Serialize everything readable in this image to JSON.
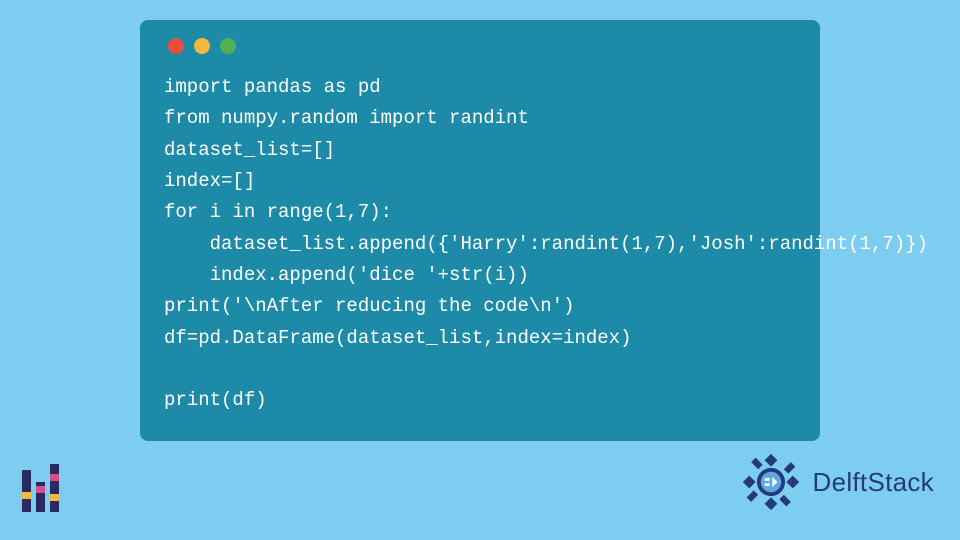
{
  "code": {
    "lines": [
      "import pandas as pd",
      "from numpy.random import randint",
      "dataset_list=[]",
      "index=[]",
      "for i in range(1,7):",
      "    dataset_list.append({'Harry':randint(1,7),'Josh':randint(1,7)})",
      "    index.append('dice '+str(i))",
      "print('\\nAfter reducing the code\\n')",
      "df=pd.DataFrame(dataset_list,index=index)",
      "",
      "print(df)"
    ]
  },
  "brand": {
    "name": "DelftStack"
  },
  "colors": {
    "page_bg": "#7dcdf0",
    "code_bg": "#1d8ba7",
    "code_fg": "#ffffff",
    "dot_red": "#e94f3c",
    "dot_yellow": "#f4b83e",
    "dot_green": "#4fb153",
    "brand_text": "#253a7a"
  }
}
